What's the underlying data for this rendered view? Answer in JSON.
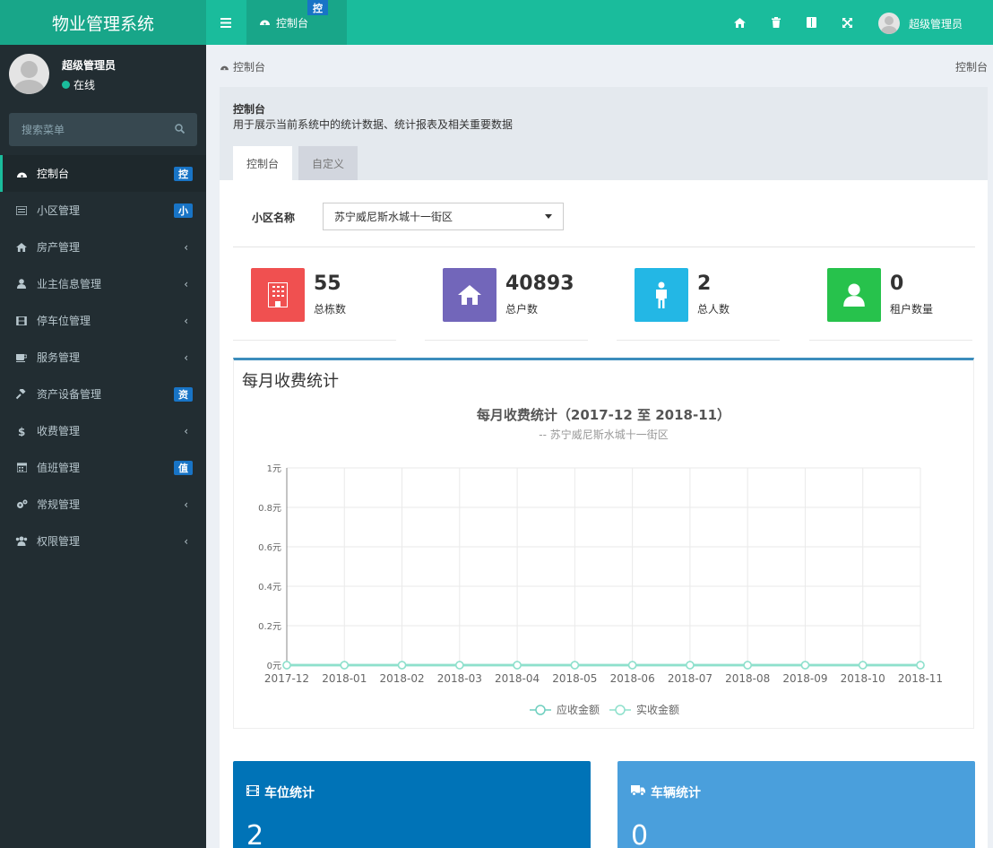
{
  "app": {
    "title": "物业管理系统"
  },
  "topbar": {
    "tab_label": "控制台",
    "tab_badge": "控",
    "user_name": "超级管理员",
    "icons": [
      "home-icon",
      "trash-icon",
      "book-icon",
      "fullscreen-icon"
    ]
  },
  "sidebar": {
    "user_name": "超级管理员",
    "status": "在线",
    "search_placeholder": "搜索菜单",
    "items": [
      {
        "label": "控制台",
        "icon": "dashboard-icon",
        "badge": "控"
      },
      {
        "label": "小区管理",
        "icon": "list-icon",
        "badge": "小"
      },
      {
        "label": "房产管理",
        "icon": "home-icon",
        "arrow": "‹"
      },
      {
        "label": "业主信息管理",
        "icon": "user-icon",
        "arrow": "‹"
      },
      {
        "label": "停车位管理",
        "icon": "film-icon",
        "arrow": "‹"
      },
      {
        "label": "服务管理",
        "icon": "coffee-icon",
        "arrow": "‹"
      },
      {
        "label": "资产设备管理",
        "icon": "gavel-icon",
        "badge": "资"
      },
      {
        "label": "收费管理",
        "icon": "dollar-icon",
        "arrow": "‹"
      },
      {
        "label": "值班管理",
        "icon": "calendar-icon",
        "badge": "值"
      },
      {
        "label": "常规管理",
        "icon": "cogs-icon",
        "arrow": "‹"
      },
      {
        "label": "权限管理",
        "icon": "users-icon",
        "arrow": "‹"
      }
    ]
  },
  "breadcrumb": {
    "left": "控制台",
    "right": "控制台"
  },
  "panel": {
    "title": "控制台",
    "description": "用于展示当前系统中的统计数据、统计报表及相关重要数据",
    "tabs": [
      "控制台",
      "自定义"
    ]
  },
  "community": {
    "label": "小区名称",
    "selected": "苏宁威尼斯水城十一街区"
  },
  "stats": [
    {
      "value": "55",
      "label": "总栋数",
      "color": "#f05050",
      "icon": "building-icon"
    },
    {
      "value": "40893",
      "label": "总户数",
      "color": "#7266ba",
      "icon": "home-icon"
    },
    {
      "value": "2",
      "label": "总人数",
      "color": "#23b7e5",
      "icon": "person-icon"
    },
    {
      "value": "0",
      "label": "租户数量",
      "color": "#27c24c",
      "icon": "user-icon"
    }
  ],
  "chart_box_title": "每月收费统计",
  "chart_data": {
    "type": "line",
    "title": "每月收费统计（2017-12 至 2018-11）",
    "subtitle": "-- 苏宁威尼斯水城十一街区",
    "categories": [
      "2017-12",
      "2018-01",
      "2018-02",
      "2018-03",
      "2018-04",
      "2018-05",
      "2018-06",
      "2018-07",
      "2018-08",
      "2018-09",
      "2018-10",
      "2018-11"
    ],
    "y_ticks": [
      "0元",
      "0.2元",
      "0.4元",
      "0.6元",
      "0.8元",
      "1元"
    ],
    "ylim": [
      0,
      1
    ],
    "grid": true,
    "legend_position": "bottom",
    "series": [
      {
        "name": "应收金额",
        "values": [
          0,
          0,
          0,
          0,
          0,
          0,
          0,
          0,
          0,
          0,
          0,
          0
        ],
        "color": "#6fcfbf"
      },
      {
        "name": "实收金额",
        "values": [
          0,
          0,
          0,
          0,
          0,
          0,
          0,
          0,
          0,
          0,
          0,
          0
        ],
        "color": "#8ee0cc"
      }
    ]
  },
  "cards": [
    {
      "title": "车位统计",
      "value": "2",
      "icon": "film-icon",
      "color": "#0073b7"
    },
    {
      "title": "车辆统计",
      "value": "0",
      "icon": "truck-icon",
      "color": "#4a9fdc"
    }
  ]
}
